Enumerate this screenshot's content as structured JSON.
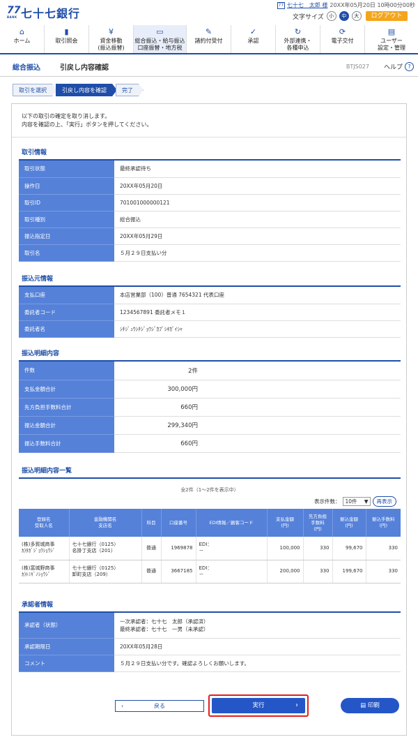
{
  "header": {
    "logo_num": "77",
    "logo_sub": "BANK",
    "logo_text": "七十七銀行",
    "user_icon": "77",
    "user_name": "七十七　太郎 様",
    "login_time": "20XX年05月20日 10時00分00秒",
    "font_size_label": "文字サイズ",
    "font_small": "小",
    "font_mid": "中",
    "font_large": "大",
    "logout": "ログアウト"
  },
  "nav": [
    {
      "icon": "home-icon",
      "l1": "ホーム",
      "l2": ""
    },
    {
      "icon": "document-icon",
      "l1": "取引照会",
      "l2": ""
    },
    {
      "icon": "yen-icon",
      "l1": "資金移動",
      "l2": "(振込振替)"
    },
    {
      "icon": "card-icon",
      "l1": "総合振込・給与振込",
      "l2": "口座振替・地方税"
    },
    {
      "icon": "contract-icon",
      "l1": "諸約付受付",
      "l2": ""
    },
    {
      "icon": "approve-icon",
      "l1": "承認",
      "l2": ""
    },
    {
      "icon": "link-icon",
      "l1": "外部連携・",
      "l2": "各種申込"
    },
    {
      "icon": "transfer-icon",
      "l1": "電子交付",
      "l2": ""
    },
    {
      "icon": "user-settings-icon",
      "l1": "ユーザー",
      "l2": "設定・管理"
    }
  ],
  "titlebar": {
    "main": "総合振込",
    "sub": "引戻し内容確認",
    "code": "BTJS027",
    "help": "ヘルプ",
    "help_icon": "?"
  },
  "steps": [
    "取引を選択",
    "引戻し内容を確認",
    "完了"
  ],
  "intro": [
    "以下の取引の確定を取り消します。",
    "内容を確認の上、「実行」ボタンを押してください。"
  ],
  "torihiki": {
    "title": "取引情報",
    "rows": [
      [
        "取引状態",
        "最終承認待ち"
      ],
      [
        "操作日",
        "20XX年05月20日"
      ],
      [
        "取引ID",
        "701001000000121"
      ],
      [
        "取引種別",
        "総合振込"
      ],
      [
        "振込指定日",
        "20XX年05月29日"
      ],
      [
        "取引名",
        "５月２９日支払い分"
      ]
    ]
  },
  "motoinfo": {
    "title": "振込元情報",
    "rows": [
      [
        "支払口座",
        "本店営業部（100）普通 7654321 代表口座"
      ],
      [
        "委託者コード",
        "1234567891 委託者メモ１"
      ],
      [
        "委託者名",
        "ｼﾁｼﾞｭｳｼﾁｼﾞｮｳｼﾞｶﾌﾞｼｷｶﾞｲｼｬ"
      ]
    ]
  },
  "meisai": {
    "title": "振込明細内容",
    "rows": [
      [
        "件数",
        "2件"
      ],
      [
        "支払金額合計",
        "300,000円"
      ],
      [
        "先方負担手数料合計",
        "660円"
      ],
      [
        "振込金額合計",
        "299,340円"
      ],
      [
        "振込手数料合計",
        "660円"
      ]
    ]
  },
  "list": {
    "title": "振込明細内容一覧",
    "meta": "全2件（1〜2件を表示中）",
    "count_label": "表示件数：",
    "count_value": "10件",
    "redisplay": "再表示",
    "headers": [
      "登録名\n受取人名",
      "金融機関名\n支店名",
      "科目",
      "口座番号",
      "EDI情報／顧客コード",
      "支払金額\n(円)",
      "先方負担\n手数料\n(円)",
      "振込金額\n(円)",
      "振込手数料\n(円)"
    ],
    "rows": [
      [
        "(株)多賀城商事\nｶ)ﾀｶﾞｼﾞｮｳｼｮｳｼﾞ",
        "七十七銀行（0125）\n名掛丁支店（201）",
        "普通",
        "1969878",
        "EDI：\n－",
        "100,000",
        "330",
        "99,670",
        "330"
      ],
      [
        "(株)富城野商事\nｶ)ﾄﾐｷﾞﾉｼｮｳｼﾞ",
        "七十七銀行（0125）\n卸町支店（209）",
        "普通",
        "3667185",
        "EDI：\n－",
        "200,000",
        "330",
        "199,670",
        "330"
      ]
    ]
  },
  "shonin": {
    "title": "承認者情報",
    "rows": [
      [
        "承認者（状態）",
        "一次承認者：七十七　太郎（承認済）\n最終承認者：七十七　一男（未承認）"
      ],
      [
        "承認期限日",
        "20XX年05月28日"
      ],
      [
        "コメント",
        "５月２９日支払い分です。確認よろしくお願いします。"
      ]
    ]
  },
  "buttons": {
    "back": "戻る",
    "exec": "実行",
    "print": "印刷"
  },
  "colors": {
    "brand": "#1f4ea8",
    "header_cell": "#5581d9",
    "logout": "#f4a51c",
    "highlight": "#e02020"
  }
}
